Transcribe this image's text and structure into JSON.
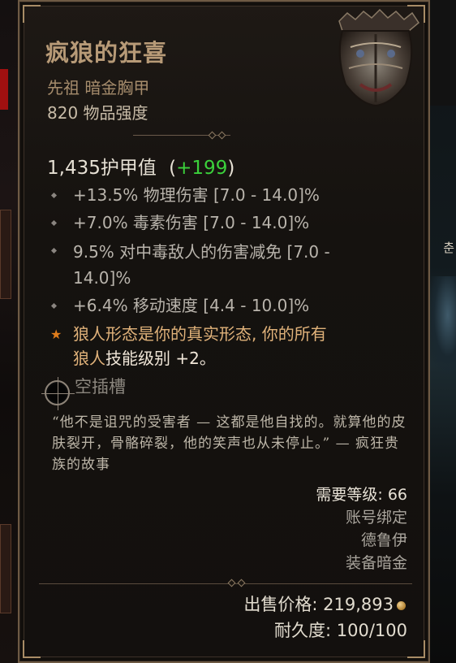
{
  "item": {
    "name": "疯狼的狂喜",
    "type": "先祖 暗金胸甲",
    "item_power": "820 物品强度",
    "armor_value": "1,435护甲值",
    "armor_bonus": "+199",
    "affixes": [
      {
        "text": "+13.5% 物理伤害 [7.0 - 14.0]%"
      },
      {
        "text": "+7.0% 毒素伤害 [7.0 - 14.0]%"
      },
      {
        "text": "9.5% 对中毒敌人的伤害减免 [7.0 - 14.0]%"
      },
      {
        "text": "+6.4% 移动速度 [4.4 - 10.0]%"
      }
    ],
    "legendary_text_1": "狼人形态是你的真实形态, 你的所有",
    "legendary_text_2a": "狼人",
    "legendary_text_2b": "技能级别",
    "legendary_text_2c": " +2。",
    "socket_label": "空插槽",
    "flavor_text": "“他不是诅咒的受害者 — 这都是他自找的。就算他的皮肤裂开，骨骼碎裂，他的笑声也从未停止。” — 疯狂贵族的故事",
    "requirements": {
      "level": "需要等级: 66",
      "bind": "账号绑定",
      "class": "德鲁伊",
      "equip": "装备暗金"
    },
    "sell_price": "出售价格: 219,893",
    "durability": "耐久度: 100/100"
  },
  "background": {
    "right_glyph": "춘"
  },
  "colors": {
    "title": "#b79a77",
    "bonus_green": "#3bd13b",
    "legendary_orange": "#e0b27a",
    "star": "#e07d1c"
  }
}
